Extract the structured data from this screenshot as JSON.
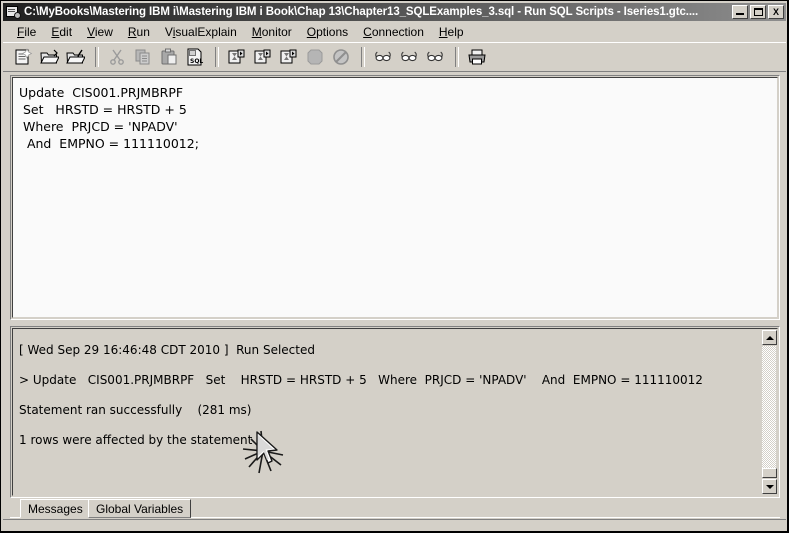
{
  "window": {
    "title": "C:\\MyBooks\\Mastering IBM i\\Mastering IBM i Book\\Chap 13\\Chapter13_SQLExamples_3.sql - Run SQL Scripts - Iseries1.gtc....",
    "icon": "sql-script-document-icon",
    "minimize_label": "_",
    "maximize_label": "□",
    "close_label": "X"
  },
  "menubar": {
    "items": [
      {
        "label": "File",
        "mnemonic": "F",
        "pre": "",
        "post": "ile"
      },
      {
        "label": "Edit",
        "mnemonic": "E",
        "pre": "",
        "post": "dit"
      },
      {
        "label": "View",
        "mnemonic": "V",
        "pre": "",
        "post": "iew"
      },
      {
        "label": "Run",
        "mnemonic": "R",
        "pre": "",
        "post": "un"
      },
      {
        "label": "VisualExplain",
        "mnemonic": "i",
        "pre": "V",
        "post": "sualExplain"
      },
      {
        "label": "Monitor",
        "mnemonic": "M",
        "pre": "",
        "post": "onitor"
      },
      {
        "label": "Options",
        "mnemonic": "O",
        "pre": "",
        "post": "ptions"
      },
      {
        "label": "Connection",
        "mnemonic": "C",
        "pre": "",
        "post": "onnection"
      },
      {
        "label": "Help",
        "mnemonic": "H",
        "pre": "",
        "post": "elp"
      }
    ]
  },
  "toolbar": {
    "buttons": [
      {
        "name": "new-script-icon",
        "tooltip": "New",
        "enabled": true
      },
      {
        "name": "open-folder-icon",
        "tooltip": "Open",
        "enabled": true
      },
      {
        "name": "save-folder-icon",
        "tooltip": "Save",
        "enabled": true
      },
      {
        "name": "cut-scissors-icon",
        "tooltip": "Cut",
        "enabled": false
      },
      {
        "name": "copy-pages-icon",
        "tooltip": "Copy",
        "enabled": false
      },
      {
        "name": "paste-clipboard-icon",
        "tooltip": "Paste",
        "enabled": false
      },
      {
        "name": "insert-sql-icon",
        "tooltip": "Insert SQL",
        "enabled": true
      },
      {
        "name": "run-all-hourglass-icon",
        "tooltip": "Run All",
        "enabled": true
      },
      {
        "name": "run-from-hourglass-icon",
        "tooltip": "Run From Selected",
        "enabled": true
      },
      {
        "name": "run-selected-hourglass-icon",
        "tooltip": "Run Selected",
        "enabled": true
      },
      {
        "name": "stop-octagon-icon",
        "tooltip": "Stop",
        "enabled": false
      },
      {
        "name": "cancel-prohibit-icon",
        "tooltip": "Cancel",
        "enabled": false
      },
      {
        "name": "visual-explain-glasses-icon",
        "tooltip": "Visual Explain",
        "enabled": true
      },
      {
        "name": "explain-only-glasses-icon",
        "tooltip": "Explain Only",
        "enabled": true
      },
      {
        "name": "run-explain-glasses-icon",
        "tooltip": "Run and Explain",
        "enabled": true
      },
      {
        "name": "print-icon",
        "tooltip": "Print",
        "enabled": true
      }
    ]
  },
  "editor": {
    "sql": "Update  CIS001.PRJMBRPF\n Set   HRSTD = HRSTD + 5\n Where  PRJCD = 'NPADV'\n  And  EMPNO = 111110012;"
  },
  "messages": {
    "lines": [
      "[ Wed Sep 29 16:46:48 CDT 2010 ]  Run Selected",
      "> Update   CIS001.PRJMBRPF   Set    HRSTD = HRSTD + 5   Where  PRJCD = 'NPADV'    And  EMPNO = 111110012",
      "Statement ran successfully    (281 ms)",
      "1 rows were affected by the statement"
    ]
  },
  "tabs": [
    {
      "label": "Messages",
      "selected": true
    },
    {
      "label": "Global Variables",
      "selected": false
    }
  ],
  "colors": {
    "window_face": "#d4d0c8",
    "editor_bg": "#fafafa",
    "title_start": "#202020",
    "title_end": "#8e8e8e",
    "text": "#000000"
  }
}
